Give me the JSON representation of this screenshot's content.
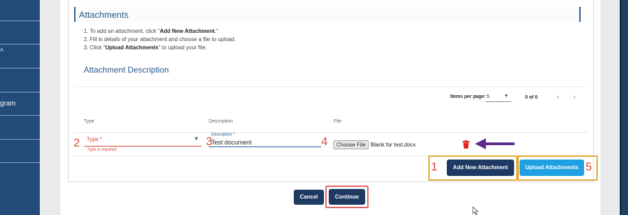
{
  "sidebar": {
    "partial_text": "gram",
    "dot_text": "˄"
  },
  "attachments": {
    "title": "Attachments",
    "instructions": [
      {
        "pre": "1. To add an attachment, click \"",
        "bold": "Add New Attachment",
        "post": ".\""
      },
      {
        "pre": "2. Fill in details of your attachment and choose a file to upload.",
        "bold": "",
        "post": ""
      },
      {
        "pre": "3. Click \"",
        "bold": "Upload Attachments",
        "post": "\" to upload your file."
      }
    ],
    "description_title": "Attachment Description"
  },
  "pagination": {
    "items_per_page_label": "Items per page:",
    "items_per_page_value": "5",
    "count": "0 of 0",
    "prev_icon": "chevron-left-icon",
    "next_icon": "chevron-right-icon"
  },
  "table": {
    "headers": {
      "type": "Type",
      "description": "Description",
      "file": "File"
    },
    "row": {
      "type_placeholder": "Type *",
      "type_error": "Type is required",
      "description_label": "Description *",
      "description_value": "Test document",
      "choose_file_label": "Choose File",
      "file_name": "Blank for test.docx"
    }
  },
  "annotations": {
    "n1": "1",
    "n2": "2",
    "n3": "3",
    "n4": "4",
    "n5": "5"
  },
  "buttons": {
    "add_new": "Add New Attachment",
    "upload": "Upload Attachments",
    "cancel": "Cancel",
    "continue": "Continue"
  },
  "colors": {
    "sidebar": "#234a78",
    "primary_button": "#1e3a62",
    "upload_button": "#1ea0e2",
    "error": "#d9493b",
    "highlight_orange": "#e2a833",
    "highlight_red": "#e06464",
    "arrow_purple": "#5b2d8e",
    "trash_red": "#e02020"
  }
}
